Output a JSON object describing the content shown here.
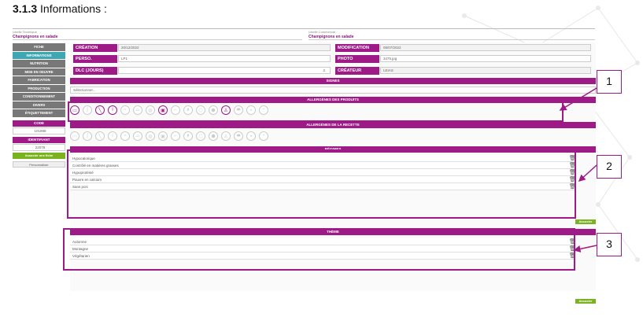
{
  "doc_heading": {
    "number": "3.1.3",
    "title": "Informations :"
  },
  "header": {
    "libelle_technique_label": "Libellé Technique",
    "libelle_technique_value": "Champignons en salade",
    "libelle_commercial_label": "Libellé Commercial",
    "libelle_commercial_value": "Champignons en salade"
  },
  "sidebar": {
    "items": [
      {
        "label": "FICHE"
      },
      {
        "label": "INFORMATIONS"
      },
      {
        "label": "NUTRITION"
      },
      {
        "label": "MISE EN OEUVRE"
      },
      {
        "label": "FABRICATION"
      },
      {
        "label": "PRODUCTION"
      },
      {
        "label": "CONDITIONNEMENT"
      },
      {
        "label": "DIVERS"
      },
      {
        "label": "ÉTIQUETTEMENT"
      }
    ],
    "code_label": "CODE",
    "code_value": "101888",
    "identifiant_label": "IDENTIFIANT",
    "identifiant_value": "22078",
    "green_button": "Associer une fiche",
    "grey_button": "Personnaliser"
  },
  "form": {
    "creation_label": "CRÉATION",
    "creation_value": "20/12/2022",
    "modification_label": "MODIFICATION",
    "modification_value": "05/07/2022",
    "perso_label": "PERSO.",
    "perso_value": "LP1",
    "photo_label": "PHOTO",
    "photo_value": "3475.jpg",
    "dlc_label": "DLC (JOURS)",
    "dlc_value": "2",
    "createur_label": "CRÉATEUR",
    "createur_value": "LEIAS"
  },
  "signes": {
    "title": "SIGNES",
    "placeholder": "Sélectionner..."
  },
  "allergenes_produits": {
    "title": "ALLERGÈNES DES PRODUITS"
  },
  "allergenes_recette": {
    "title": "ALLERGÈNES DE LA RECETTE"
  },
  "regimes": {
    "title": "RÉGIMES",
    "items": [
      {
        "label": "Hypocalorique"
      },
      {
        "label": "Contrôlé en matières grasses"
      },
      {
        "label": "Hypoprotéiné"
      },
      {
        "label": "Pauvre en calcium"
      },
      {
        "label": "Sans porc"
      }
    ],
    "add_button": "Associer"
  },
  "theme": {
    "title": "THÈME",
    "items": [
      {
        "label": "Automne"
      },
      {
        "label": "Montagne"
      },
      {
        "label": "Végétarien"
      }
    ],
    "add_button": "Associer"
  },
  "callouts": {
    "one": "1",
    "two": "2",
    "three": "3"
  },
  "colors": {
    "accent": "#9e1a86",
    "teal": "#3fa7b3",
    "green": "#7ab31f",
    "grey": "#787878"
  },
  "icons": {
    "allergen_icons": [
      "gluten-icon",
      "crustacean-icon",
      "egg-icon",
      "fish-icon",
      "peanut-icon",
      "soy-icon",
      "milk-icon",
      "nut-icon",
      "celery-icon",
      "mustard-icon",
      "sesame-icon",
      "sulphite-icon",
      "lupin-icon",
      "mollusc-icon"
    ]
  }
}
